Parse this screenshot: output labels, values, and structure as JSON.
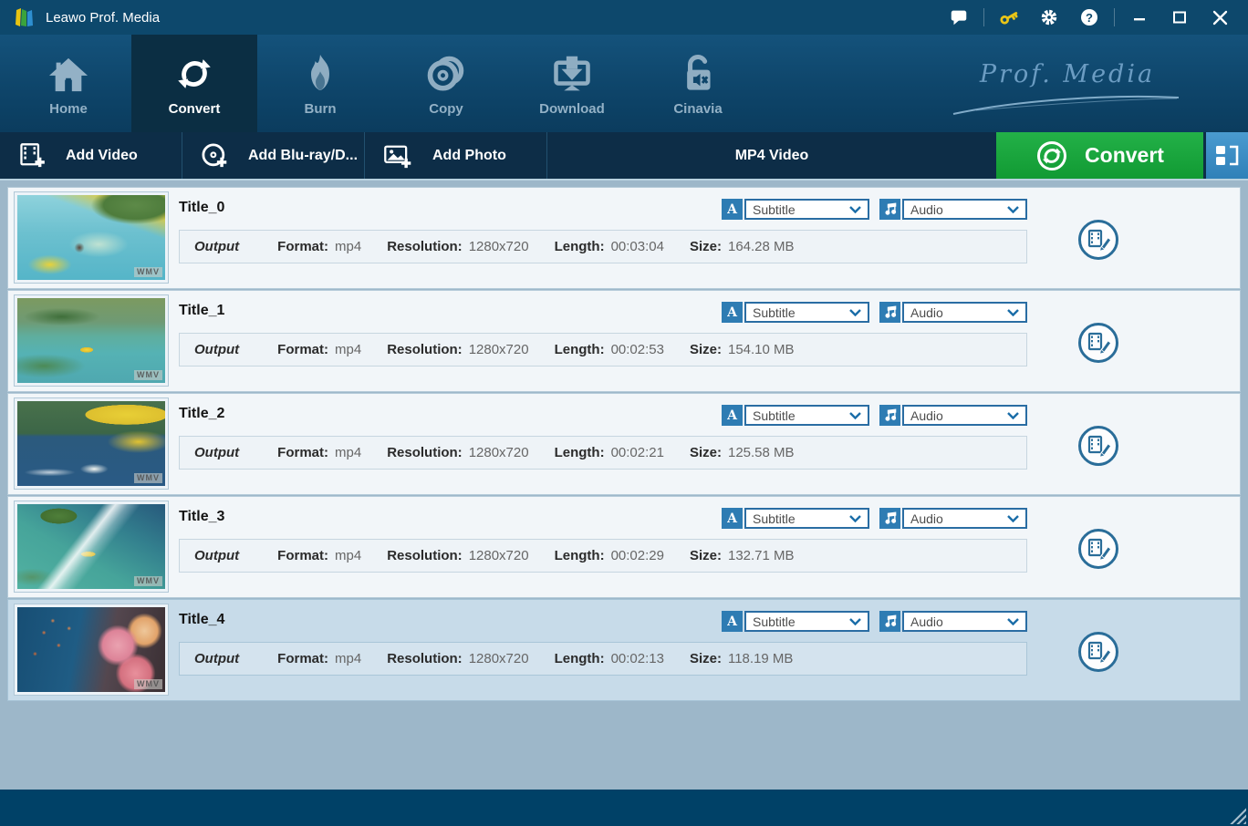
{
  "window": {
    "app_title": "Leawo Prof. Media",
    "brand_script": "Prof. Media"
  },
  "nav": {
    "tabs": [
      {
        "label": "Home"
      },
      {
        "label": "Convert",
        "active": true
      },
      {
        "label": "Burn"
      },
      {
        "label": "Copy"
      },
      {
        "label": "Download"
      },
      {
        "label": "Cinavia"
      }
    ]
  },
  "toolbar": {
    "add_video": "Add Video",
    "add_bluray": "Add Blu-ray/D...",
    "add_photo": "Add Photo",
    "output_format": "MP4 Video",
    "convert": "Convert"
  },
  "labels": {
    "output": "Output",
    "format": "Format:",
    "resolution": "Resolution:",
    "length": "Length:",
    "size": "Size:",
    "watermark": "WMV"
  },
  "icons": {
    "subtitle_glyph": "A",
    "help_glyph": "?"
  },
  "colors": {
    "titlebar": "#0d486c",
    "accent_green": "#17a53c",
    "accent_blue": "#3a8fc8",
    "selected_row": "#c7dbe9"
  },
  "rows": [
    {
      "title": "Title_0",
      "subtitle": "Subtitle",
      "audio": "Audio",
      "format": "mp4",
      "resolution": "1280x720",
      "length": "00:03:04",
      "size": "164.28 MB",
      "thumbnail": "hang-glider-cockpit-over-lagoon",
      "selected": false
    },
    {
      "title": "Title_1",
      "subtitle": "Subtitle",
      "audio": "Audio",
      "format": "mp4",
      "resolution": "1280x720",
      "length": "00:02:53",
      "size": "154.10 MB",
      "thumbnail": "aerial-lagoon-with-small-plane",
      "selected": false
    },
    {
      "title": "Title_2",
      "subtitle": "Subtitle",
      "audio": "Audio",
      "format": "mp4",
      "resolution": "1280x720",
      "length": "00:02:21",
      "size": "125.58 MB",
      "thumbnail": "ultralight-plane-over-bay-with-boat",
      "selected": false
    },
    {
      "title": "Title_3",
      "subtitle": "Subtitle",
      "audio": "Audio",
      "format": "mp4",
      "resolution": "1280x720",
      "length": "00:02:29",
      "size": "132.71 MB",
      "thumbnail": "island-reef-with-yellow-plane",
      "selected": false
    },
    {
      "title": "Title_4",
      "subtitle": "Subtitle",
      "audio": "Audio",
      "format": "mp4",
      "resolution": "1280x720",
      "length": "00:02:13",
      "size": "118.19 MB",
      "thumbnail": "coral-reef-with-fish",
      "selected": true
    }
  ]
}
